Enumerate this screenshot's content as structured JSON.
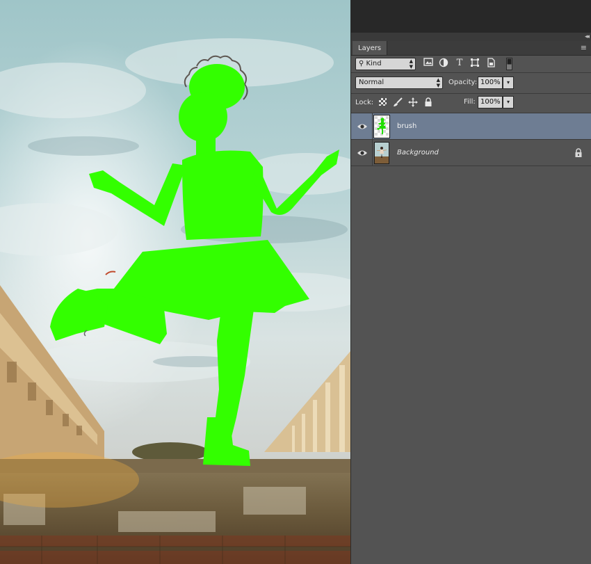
{
  "panel": {
    "tab_label": "Layers",
    "filter": {
      "kind_label": "Kind",
      "icons": [
        "image-filter-icon",
        "adjustment-filter-icon",
        "type-filter-icon",
        "shape-filter-icon",
        "smart-object-filter-icon",
        "filter-toggle-icon"
      ]
    },
    "blend_mode": "Normal",
    "opacity_label": "Opacity:",
    "opacity_value": "100%",
    "lock_label": "Lock:",
    "fill_label": "Fill:",
    "fill_value": "100%",
    "layers": [
      {
        "name": "brush",
        "visible": true,
        "selected": true,
        "locked": false,
        "italic": false
      },
      {
        "name": "Background",
        "visible": true,
        "selected": false,
        "locked": true,
        "italic": true
      }
    ]
  },
  "colors": {
    "mask_green": "#33ff00",
    "panel_bg": "#535353",
    "selected_row": "#6e7d93",
    "workspace_dark": "#282828"
  }
}
